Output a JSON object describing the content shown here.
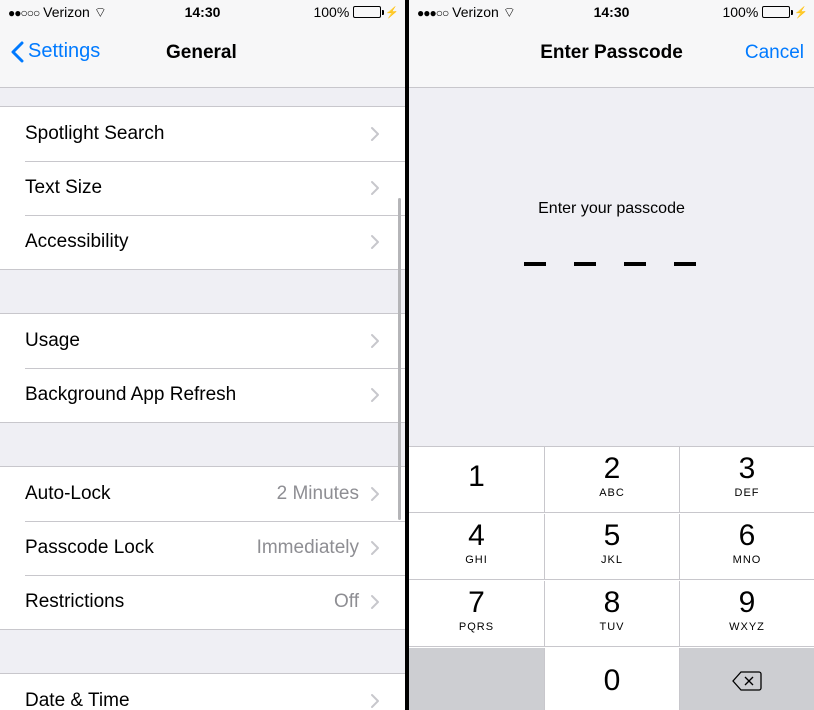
{
  "status": {
    "carrier": "Verizon",
    "signal_dots": "●●○○○",
    "signal_dots_right": "●●●○○",
    "time": "14:30",
    "battery": "100%",
    "battery_level": 1.0
  },
  "settings_screen": {
    "back_label": "Settings",
    "title": "General",
    "groups": [
      [
        {
          "label": "Spotlight Search",
          "value": ""
        },
        {
          "label": "Text Size",
          "value": ""
        },
        {
          "label": "Accessibility",
          "value": ""
        }
      ],
      [
        {
          "label": "Usage",
          "value": ""
        },
        {
          "label": "Background App Refresh",
          "value": ""
        }
      ],
      [
        {
          "label": "Auto-Lock",
          "value": "2 Minutes"
        },
        {
          "label": "Passcode Lock",
          "value": "Immediately"
        },
        {
          "label": "Restrictions",
          "value": "Off"
        }
      ],
      [
        {
          "label": "Date & Time",
          "value": ""
        }
      ]
    ]
  },
  "passcode_screen": {
    "title": "Enter Passcode",
    "cancel_label": "Cancel",
    "prompt": "Enter your passcode",
    "keys": [
      {
        "digit": "1",
        "letters": ""
      },
      {
        "digit": "2",
        "letters": "ABC"
      },
      {
        "digit": "3",
        "letters": "DEF"
      },
      {
        "digit": "4",
        "letters": "GHI"
      },
      {
        "digit": "5",
        "letters": "JKL"
      },
      {
        "digit": "6",
        "letters": "MNO"
      },
      {
        "digit": "7",
        "letters": "PQRS"
      },
      {
        "digit": "8",
        "letters": "TUV"
      },
      {
        "digit": "9",
        "letters": "WXYZ"
      },
      {
        "digit": "0",
        "letters": ""
      }
    ],
    "delete_icon": "backspace-icon"
  },
  "colors": {
    "accent": "#007aff",
    "battery": "#4cd964",
    "background": "#efeff4",
    "secondary_text": "#8e8e93"
  }
}
